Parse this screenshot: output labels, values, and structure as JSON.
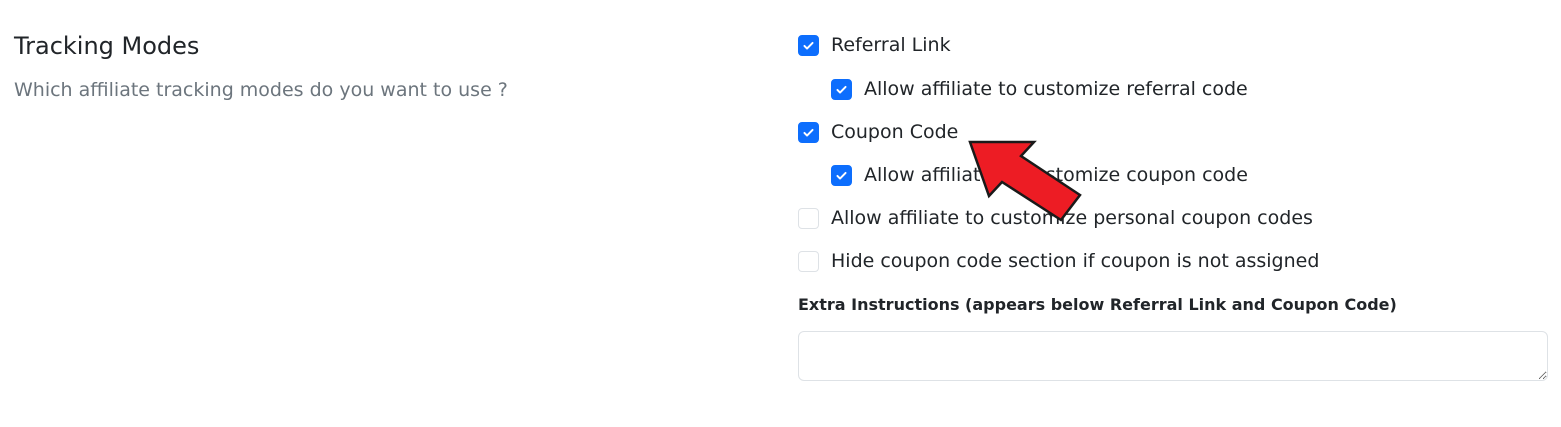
{
  "section": {
    "title": "Tracking Modes",
    "description": "Which affiliate tracking modes do you want to use ?"
  },
  "options": [
    {
      "label": "Referral Link",
      "checked": true
    },
    {
      "label": "Allow affiliate to customize referral code",
      "checked": true
    },
    {
      "label": "Coupon Code",
      "checked": true
    },
    {
      "label": "Allow affiliate to customize coupon code",
      "checked": true
    },
    {
      "label": "Allow affiliate to customize personal coupon codes",
      "checked": false
    },
    {
      "label": "Hide coupon code section if coupon is not assigned",
      "checked": false
    }
  ],
  "extra_instructions": {
    "label": "Extra Instructions (appears below Referral Link and Coupon Code)",
    "value": ""
  },
  "colors": {
    "accent": "#0d6efd",
    "annotation_arrow": "#ed1c24"
  },
  "icons": {
    "checkmark": "check-icon",
    "annotation": "red-arrow-icon"
  }
}
